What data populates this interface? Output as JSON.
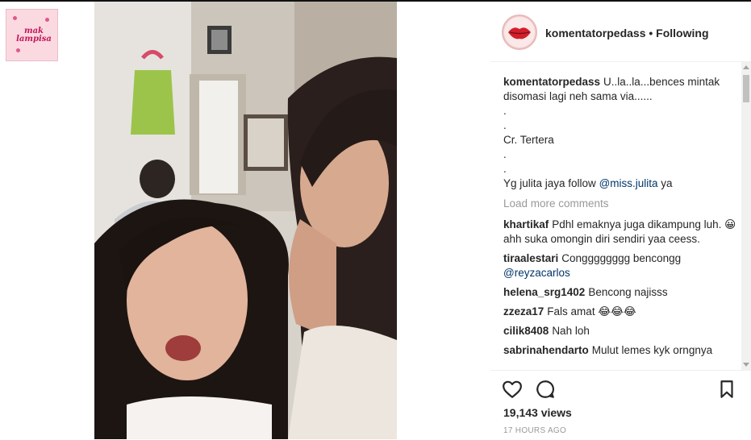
{
  "thumbnail": {
    "text": "mak lampisa"
  },
  "header": {
    "username": "komentatorpedass",
    "separator": " • ",
    "follow_status": "Following"
  },
  "caption": {
    "username": "komentatorpedass",
    "text_line1": "U..la..la...bences mintak disomasi lagi neh sama via......",
    "lines": [
      ".",
      ".",
      "Cr. Tertera",
      ".",
      "."
    ],
    "final_prefix": "Yg julita jaya follow ",
    "final_mention": "@miss.julita",
    "final_suffix": " ya"
  },
  "load_more": "Load more comments",
  "comments": [
    {
      "user": "khartikaf",
      "text": "Pdhl emaknya juga dikampung luh. 😀 ahh suka omongin diri sendiri yaa ceess."
    },
    {
      "user": "tiraalestari",
      "text": "Congggggggg bencongg ",
      "mention": "@reyzacarlos"
    },
    {
      "user": "helena_srg1402",
      "text": "Bencong najisss"
    },
    {
      "user": "zzeza17",
      "text": "Fals amat 😂😂😂"
    },
    {
      "user": "cilik8408",
      "text": "Nah loh"
    },
    {
      "user": "sabrinahendarto",
      "text": "Mulut lemes kyk orngnya"
    }
  ],
  "stats": {
    "views": "19,143 views",
    "timestamp": "17 HOURS AGO"
  },
  "icons": {
    "like": "heart-icon",
    "comment": "comment-bubble-icon",
    "save": "bookmark-icon"
  },
  "colors": {
    "link": "#003569",
    "muted": "#999999",
    "text": "#262626"
  }
}
